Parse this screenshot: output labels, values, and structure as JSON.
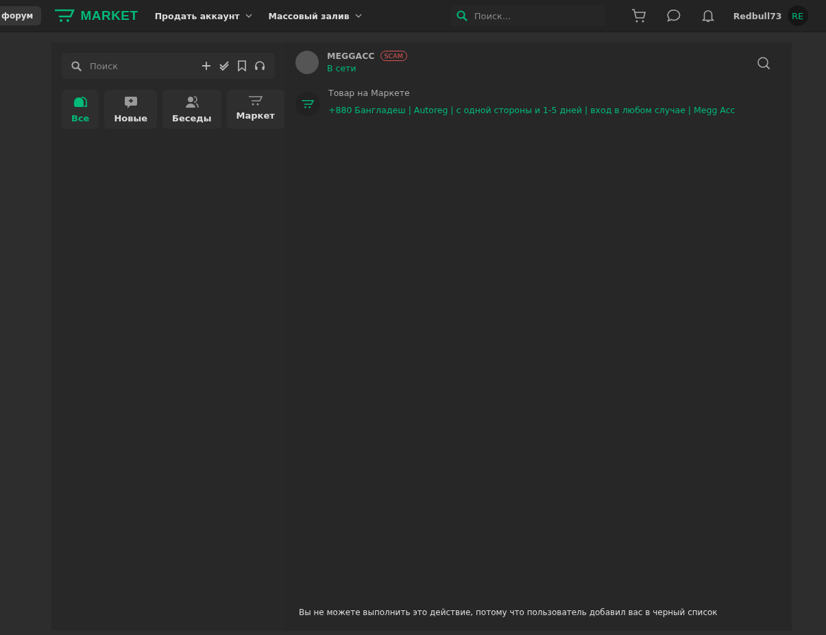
{
  "header": {
    "forum_button": "форум",
    "logo": "MARKET",
    "nav": [
      {
        "label": "Продать аккаунт"
      },
      {
        "label": "Массовый залив"
      }
    ],
    "search": {
      "placeholder": "Поиск..."
    },
    "username": "Redbull73",
    "avatar": "RE"
  },
  "sidebar": {
    "search": {
      "placeholder": "Поиск"
    },
    "tabs": [
      {
        "label": "Все",
        "kind": "all",
        "selected": true
      },
      {
        "label": "Новые",
        "kind": "new",
        "selected": false
      },
      {
        "label": "Беседы",
        "kind": "groups",
        "selected": false
      },
      {
        "label": "Маркет",
        "kind": "market",
        "selected": false
      }
    ]
  },
  "chat": {
    "user": {
      "name": "MEGGACC",
      "badge": "SCAM",
      "status": "В сети"
    },
    "item": {
      "title": "Товар на Маркете",
      "link": "+880 Бангладеш | Autoreg | с одной стороны и 1-5 дней | вход в любом случае | Megg Acc"
    },
    "notice": "Вы не можете выполнить это действие, потому что пользователь добавил вас в черный список"
  }
}
